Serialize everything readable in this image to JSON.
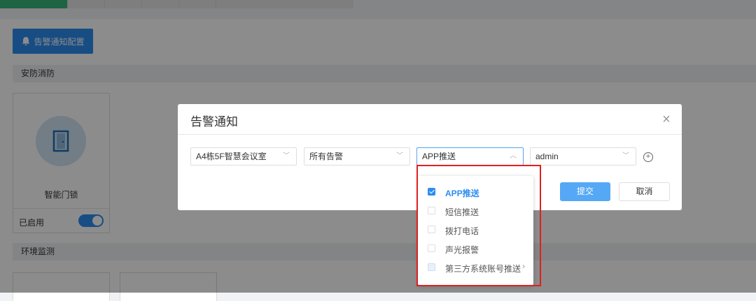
{
  "modal": {
    "title": "告警通知",
    "close_glyph": "×",
    "selects": {
      "location": "A4栋5F智慧会议室",
      "alarm_type": "所有告警",
      "notify_method": "APP推送",
      "user": "admin"
    },
    "add_glyph": "+",
    "submit_label": "提交",
    "cancel_label": "取消"
  },
  "dropdown": {
    "items": [
      {
        "label": "APP推送",
        "checked": true
      },
      {
        "label": "短信推送",
        "checked": false
      },
      {
        "label": "拨打电话",
        "checked": false
      },
      {
        "label": "声光报警",
        "checked": false
      },
      {
        "label": "第三方系统账号推送",
        "checked": false,
        "has_submenu": true
      }
    ],
    "submenu_glyph": "›"
  },
  "background": {
    "config_button_label": "告警通知配置",
    "section_security": "安防消防",
    "section_environment": "环境监测",
    "device": {
      "name": "智能门锁",
      "status": "已启用",
      "enabled": true
    }
  },
  "colors": {
    "primary": "#2d8cf0",
    "submit": "#55a8f5",
    "highlight": "#e02020",
    "active_tab": "#3bb47a"
  }
}
